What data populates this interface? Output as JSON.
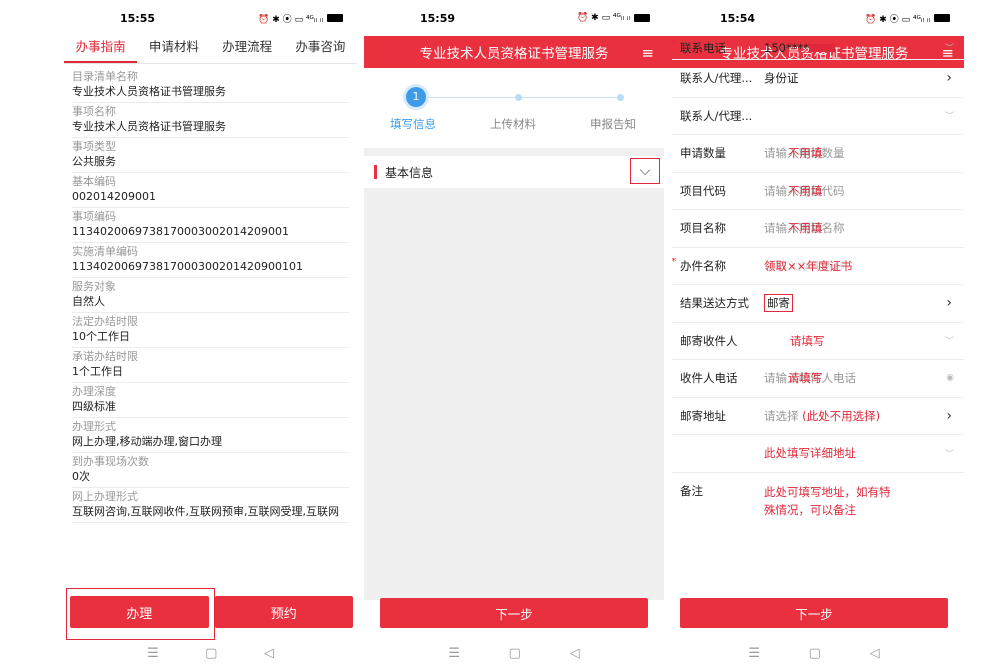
{
  "phone1": {
    "status": {
      "time": "15:55",
      "icons": "⏰ ✱ ⦿ ▭ ⁴ᴳᵢₗ ᵢₗ"
    },
    "tabs": [
      "办事指南",
      "申请材料",
      "办理流程",
      "办事咨询"
    ],
    "fields": [
      {
        "label": "目录清单名称",
        "value": "专业技术人员资格证书管理服务"
      },
      {
        "label": "事项名称",
        "value": "专业技术人员资格证书管理服务"
      },
      {
        "label": "事项类型",
        "value": "公共服务"
      },
      {
        "label": "基本编码",
        "value": "002014209001"
      },
      {
        "label": "事项编码",
        "value": "11340200697381700030020142090​01"
      },
      {
        "label": "实施清单编码",
        "value": "1134020069738170003002014209​00101"
      },
      {
        "label": "服务对象",
        "value": "自然人"
      },
      {
        "label": "法定办结时限",
        "value": "10个工作日"
      },
      {
        "label": "承诺办结时限",
        "value": "1个工作日"
      },
      {
        "label": "办理深度",
        "value": "四级标准"
      },
      {
        "label": "办理形式",
        "value": "网上办理,移动端办理,窗口办理"
      },
      {
        "label": "到办事现场次数",
        "value": "0次"
      },
      {
        "label": "网上办理形式",
        "value": "互联网咨询,互联网收件,互联网预审,互联网受理,互联网"
      }
    ],
    "buttons": {
      "handle": "办理",
      "reserve": "预约"
    },
    "nav": [
      "☰",
      "▢",
      "◁"
    ]
  },
  "phone2": {
    "status": {
      "time": "15:59",
      "icons": "⏰ ✱ ▭ ⁴ᴳᵢₗ ᵢₗ"
    },
    "header": "专业技术人员资格证书管理服务",
    "menu_icon": "≡",
    "steps": {
      "num": "1",
      "labels": [
        "填写信息",
        "上传材料",
        "申报告知"
      ]
    },
    "section": "基本信息",
    "next": "下一步",
    "nav": [
      "☰",
      "▢",
      "◁"
    ]
  },
  "phone3": {
    "status": {
      "time": "15:54",
      "icons": "⏰ ✱ ⦿ ▭ ⁴ᴳᵢₗ ᵢₗ"
    },
    "header": "专业技术人员资格证书管理服务",
    "menu_icon": "≡",
    "rows": [
      {
        "label": "联系电话",
        "value": "150****",
        "req": true
      },
      {
        "label": "联系人/代理...",
        "value": "身份证"
      },
      {
        "label": "联系人/代理..."
      },
      {
        "label": "申请数量",
        "placeholder": "请输入申请数量",
        "note": "不用填"
      },
      {
        "label": "项目代码",
        "placeholder": "请输入项目代码",
        "note": "不用填"
      },
      {
        "label": "项目名称",
        "placeholder": "请输入项目名称",
        "note": "不用填"
      },
      {
        "label": "办件名称",
        "placeholder": "请输入办件名称",
        "note": "领取××年度证书",
        "req": true
      },
      {
        "label": "结果送达方式",
        "value": "邮寄"
      },
      {
        "label": "邮寄收件人",
        "note": "请填写"
      },
      {
        "label": "收件人电话",
        "placeholder": "请输入收件人电话",
        "note": "请填写"
      },
      {
        "label": "邮寄地址",
        "placeholder": "请选择",
        "note": "(此处不用选择)"
      },
      {
        "label": "",
        "note": "此处填写详细地址"
      },
      {
        "label": "备注",
        "note": "此处可填写地址，如有特殊情况，可以备注"
      }
    ],
    "next": "下一步",
    "nav": [
      "☰",
      "▢",
      "◁"
    ]
  }
}
